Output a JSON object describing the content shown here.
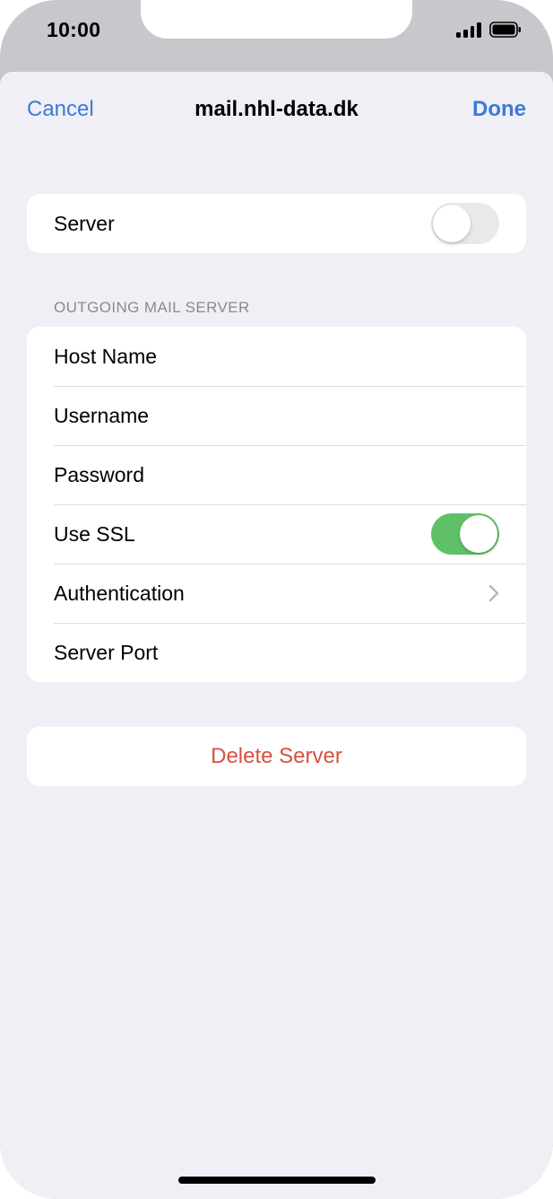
{
  "status_bar": {
    "time": "10:00",
    "signal_icon": "cellular-signal-icon",
    "battery_icon": "battery-icon"
  },
  "nav": {
    "cancel_label": "Cancel",
    "title": "mail.nhl-data.dk",
    "done_label": "Done"
  },
  "server_group": {
    "label": "Server",
    "toggle_on": false
  },
  "outgoing": {
    "header": "OUTGOING MAIL SERVER",
    "rows": {
      "host_name": "Host Name",
      "username": "Username",
      "password": "Password",
      "use_ssl": "Use SSL",
      "authentication": "Authentication",
      "server_port": "Server Port"
    },
    "use_ssl_on": true
  },
  "delete": {
    "label": "Delete Server"
  },
  "colors": {
    "accent": "#3a7bd5",
    "toggle_on": "#5ec167",
    "destructive": "#d9503f",
    "background": "#f0eff5"
  }
}
